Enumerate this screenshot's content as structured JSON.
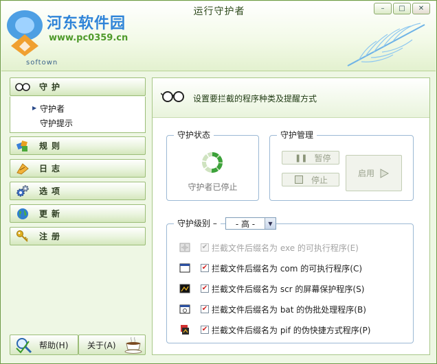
{
  "window": {
    "title": "运行守护者",
    "watermark_site": "河东软件园",
    "watermark_url": "www.pc0359.cn",
    "brand": "softown"
  },
  "nav": {
    "items": [
      {
        "label": "守护",
        "icon": "glasses-icon"
      },
      {
        "label": "规则",
        "icon": "rules-icon"
      },
      {
        "label": "日志",
        "icon": "log-icon"
      },
      {
        "label": "选项",
        "icon": "gears-icon"
      },
      {
        "label": "更新",
        "icon": "globe-icon"
      },
      {
        "label": "注册",
        "icon": "key-icon"
      }
    ],
    "sub_items": [
      "守护者",
      "守护提示"
    ],
    "selected_sub": "守护者"
  },
  "bottom": {
    "help_label": "帮助(H)",
    "about_label": "关于(A)"
  },
  "panel": {
    "header_text": "设置要拦截的程序种类及提醒方式",
    "status_group": {
      "title": "守护状态",
      "status_text": "守护者已停止"
    },
    "manage_group": {
      "title": "守护管理",
      "pause_label": "暂停",
      "stop_label": "停止",
      "start_label": "启用"
    },
    "level_group": {
      "title": "守护级别 –",
      "level_value": "- 高 -",
      "options": [
        {
          "label": "拦截文件后缀名为 exe 的可执行程序(E)",
          "checked": true,
          "enabled": false,
          "icon": "exe-icon"
        },
        {
          "label": "拦截文件后缀名为 com 的可执行程序(C)",
          "checked": true,
          "enabled": true,
          "icon": "com-icon"
        },
        {
          "label": "拦截文件后缀名为 scr 的屏幕保护程序(S)",
          "checked": true,
          "enabled": true,
          "icon": "scr-icon"
        },
        {
          "label": "拦截文件后缀名为 bat 的伪批处理程序(B)",
          "checked": true,
          "enabled": true,
          "icon": "bat-icon"
        },
        {
          "label": "拦截文件后缀名为 pif 的伪快捷方式程序(P)",
          "checked": true,
          "enabled": true,
          "icon": "pif-icon"
        }
      ]
    }
  }
}
